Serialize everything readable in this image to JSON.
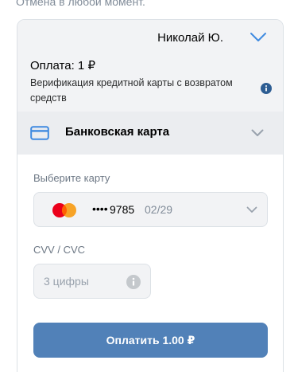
{
  "top_note": "Отмена в любой момент.",
  "user": {
    "name": "Николай Ю.",
    "chevron_icon": "chevron-down-icon"
  },
  "payment": {
    "amount_label": "Оплата: 1 ₽",
    "verification_text": "Верификация кредитной карты с возвратом средств",
    "info_icon": "info-icon"
  },
  "method": {
    "icon": "bank-card-icon",
    "label": "Банковская карта",
    "chevron_icon": "chevron-down-icon"
  },
  "card_select": {
    "label": "Выберите карту",
    "brand": "mastercard-logo",
    "dots": "••••",
    "last_digits": "9785",
    "expiry": "02/29",
    "chevron_icon": "chevron-down-icon"
  },
  "cvv": {
    "label": "CVV / CVC",
    "placeholder": "3 цифры",
    "value": "",
    "info_icon": "info-icon"
  },
  "pay_button": {
    "label": "Оплатить 1.00 ₽"
  },
  "colors": {
    "accent": "#5181b8",
    "card_icon": "#3f8ae0",
    "mastercard_red": "#eb001b",
    "mastercard_orange": "#f79e1b"
  }
}
